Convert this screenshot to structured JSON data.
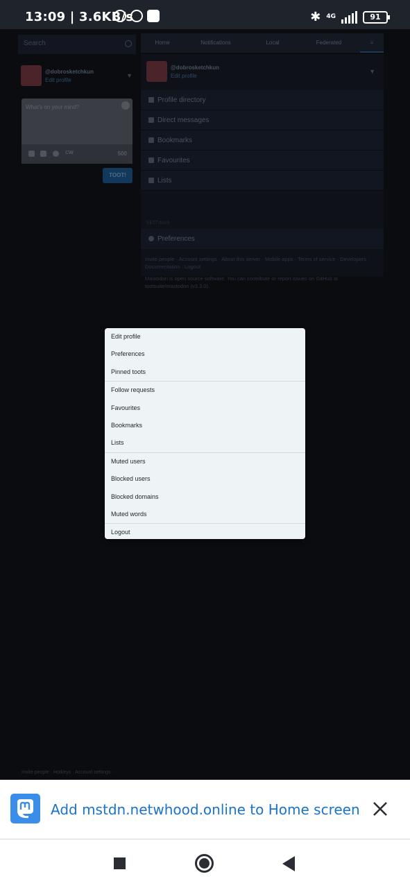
{
  "status_bar": {
    "time": "13:09 | 3.6KB/s",
    "network": "4G",
    "battery": "91"
  },
  "left_column": {
    "search_placeholder": "Search",
    "account_handle": "@dobrosketchkun",
    "edit_profile": "Edit profile",
    "composer_placeholder": "What's on your mind?",
    "cw_label": "CW",
    "char_count": "500",
    "toot_button": "TOOT!"
  },
  "column_tabs": [
    "Home",
    "Notifications",
    "Local",
    "Federated"
  ],
  "nav_panel": {
    "items": [
      "Profile directory",
      "Direct messages",
      "Bookmarks",
      "Favourites",
      "Lists"
    ],
    "settings_header": "SETTINGS",
    "preferences": "Preferences",
    "links": "Invite people · Account settings · About this server · Mobile apps · Terms of service · Developers · Documentation · Logout",
    "source_note": "Mastodon is open source software. You can contribute or report issues on GitHub at tootsuite/mastodon (v3.3.0)."
  },
  "footer_links": "Invite people · Hotkeys · Account settings ·",
  "dropdown_menu": {
    "groups": [
      [
        "Edit profile",
        "Preferences",
        "Pinned toots"
      ],
      [
        "Follow requests",
        "Favourites",
        "Bookmarks",
        "Lists"
      ],
      [
        "Muted users",
        "Blocked users",
        "Blocked domains",
        "Muted words"
      ],
      [
        "Logout"
      ]
    ]
  },
  "install_banner": {
    "text": "Add mstdn.netwhood.online to Home screen"
  },
  "colors": {
    "accent": "#1a73c8",
    "menu_bg": "#eef3f6",
    "overlay_bg": "#0a0c10"
  }
}
